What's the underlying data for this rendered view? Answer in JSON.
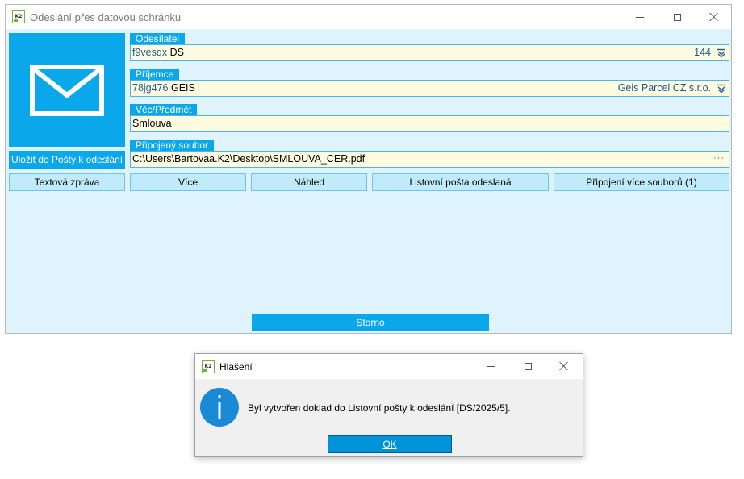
{
  "main_window": {
    "title": "Odeslání přes datovou schránku",
    "icon_text": "K2",
    "controls": [
      "minimize-icon",
      "maximize-icon",
      "close-icon"
    ],
    "mailbox_icon": "envelope-icon",
    "save_button": "Uložit do Pošty k odeslání",
    "sender": {
      "label": "Odesílatel",
      "code": "f9vesqx",
      "name": "DS",
      "right_value": "144",
      "icon": "dropdown-icon"
    },
    "recipient": {
      "label": "Příjemce",
      "code": "78jg476",
      "name": "GEIS",
      "right_value": "Geis Parcel CZ s.r.o.",
      "icon": "dropdown-icon"
    },
    "subject": {
      "label": "Věc/Předmět",
      "value": "Smlouva"
    },
    "attachment": {
      "label": "Připojený soubor",
      "value": "C:\\Users\\Bartovaa.K2\\Desktop\\SMLOUVA_CER.pdf",
      "browse": "···"
    },
    "buttons": {
      "text_message": "Textová zpráva",
      "more": "Více",
      "preview": "Náhled",
      "sent_mail": "Listovní pošta odeslaná",
      "attach_more": "Připojení více souborů (1)"
    },
    "cancel": {
      "accel": "S",
      "rest": "torno"
    }
  },
  "dialog": {
    "title": "Hlášení",
    "icon_text": "K2",
    "controls": [
      "minimize-icon",
      "maximize-icon",
      "close-icon"
    ],
    "info_icon": "info-icon",
    "message": "Byl vytvořen doklad do Listovní pošty k odeslání [DS/2025/5].",
    "ok": "OK"
  },
  "colors": {
    "accent": "#0aa7ea",
    "client_bg": "#dff3fd",
    "field_bg": "#fffbe0",
    "button_bg": "#c0ebfb",
    "dialog_ok": "#0093d8",
    "info_blue": "#1a8ad6"
  }
}
